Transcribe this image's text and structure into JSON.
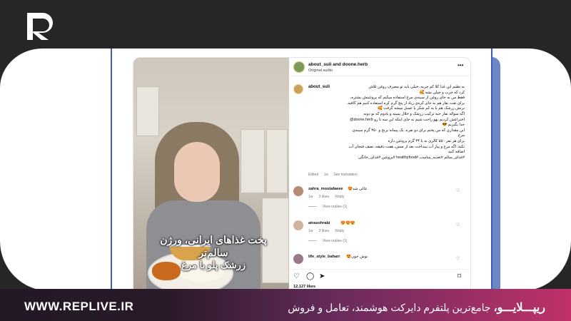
{
  "post": {
    "header_user": "about_suli and doone.herb",
    "header_audio": "Original audio",
    "caption_user": "about_suli",
    "caption_text": "به تظیم این غذا کلا کم چربه، خیلی باید تو مصرف روغن تلاش\nکرد که چرب و چیلی بشه 🥰\nفقط من به جای روغن از سینه‌ی مرغ استفاده میکنم که پروتئینش بشتره،\nبرای تفت نقار هم به جای کره‌ی زیاد از پنچ گرم کره استفاده کنیم هم کافیه.\nبرنش زرشک هم با یه کم شکر یا عسل میشه گرفت 🥰\nاگه سواله نقار جبه ترکیب زرشک و خلال پسته و بادوم که تو دونه\nاختراعش کردیم بهو راحت شیم به جای اینکه این سه تا رو doone.herb@\nجدا بگیریم 😎\nاین مقداری که من پختم برای دو نفره، یک پیمانه برنج و ۳۵۰ گرم سینه‌ی\nمرغ.\nبرای هر نفر ۵۵۰ کالری به با ۳۴ گرم پروتئین داره\nنکته: اگه مرغ و پیاز آب نینداخت بعد از ضش، هفت دقیقه، نصف فنجان آب\nاضافه کنید\n#غذای_سالم #تغذیه_مناسب #healthyfood #پروتئین #غذای_خانگی",
    "caption_meta": {
      "edited": "Edited",
      "age": "1w",
      "see_translation": "See translation"
    },
    "overlay_title": "پخت غذاهای ایرانی، ورژن سالم‌تر",
    "overlay_subtitle": "زرشک پلو با مرغ",
    "comments": [
      {
        "user": "zahra_mostafaeee",
        "text": "عالی شد😍",
        "age": "1w",
        "likes": "3 likes",
        "reply": "Reply",
        "replies": "View replies (1)"
      },
      {
        "user": "atrasohrabi",
        "text": "😍😍😍",
        "age": "1w",
        "likes": "2 likes",
        "reply": "Reply",
        "replies": "View replies (1)"
      },
      {
        "user": "life_style_baharr",
        "text": "نوش جون😍",
        "age": "1w",
        "likes": "1 like",
        "reply": "Reply",
        "replies": ""
      }
    ],
    "likes_count": "12,127 likes"
  },
  "footer": {
    "url": "WWW.REPLIVE.IR",
    "brand": "ریپـــلایـــو،",
    "tagline": "جامع‌ترین پلتفرم دایرکت هوشمند، تعامل و فروش"
  },
  "colors": {
    "dark_band": "#262626",
    "frame_blue": "#3a5fb4",
    "accent_pink": "#c0316a"
  },
  "icons": [
    "replive-logo-icon",
    "more-icon",
    "heart-icon",
    "comment-icon",
    "share-icon",
    "bookmark-icon"
  ]
}
